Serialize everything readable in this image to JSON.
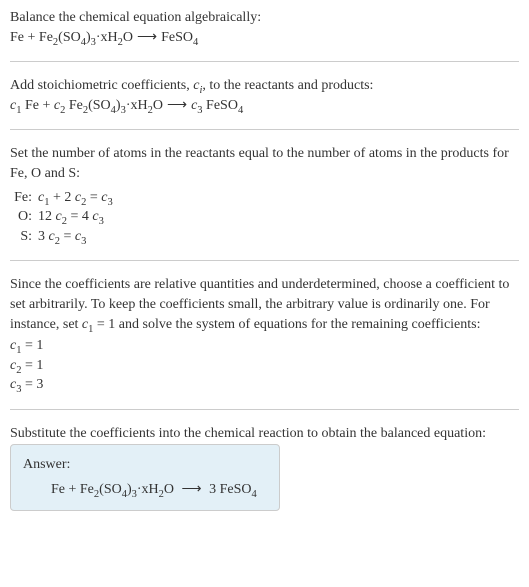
{
  "intro": {
    "line1": "Balance the chemical equation algebraically:",
    "equation_parts": {
      "r1": "Fe",
      "plus": " + ",
      "r2_a": "Fe",
      "r2_b": "(SO",
      "r2_c": ")",
      "r2_d": "·xH",
      "r2_e": "O",
      "arrow": " ⟶ ",
      "p1_a": "FeSO"
    }
  },
  "step1": {
    "text_a": "Add stoichiometric coefficients, ",
    "text_b": ", to the reactants and products:"
  },
  "step2": {
    "text": "Set the number of atoms in the reactants equal to the number of atoms in the products for Fe, O and S:",
    "rows": [
      {
        "label": "Fe:",
        "lhs_a": "c",
        "lhs_b": " + 2 ",
        "lhs_c": "c",
        "eq": " = ",
        "rhs_a": "c"
      },
      {
        "label": "O:",
        "lhs_a": "12 ",
        "lhs_b": "c",
        "eq": " = 4 ",
        "rhs_a": "c"
      },
      {
        "label": "S:",
        "lhs_a": "3 ",
        "lhs_b": "c",
        "eq": " = ",
        "rhs_a": "c"
      }
    ]
  },
  "step3": {
    "text_a": "Since the coefficients are relative quantities and underdetermined, choose a coefficient to set arbitrarily. To keep the coefficients small, the arbitrary value is ordinarily one. For instance, set ",
    "text_b": " = 1 and solve the system of equations for the remaining coefficients:",
    "coeffs": [
      {
        "var": "c",
        "sub": "1",
        "val": " = 1"
      },
      {
        "var": "c",
        "sub": "2",
        "val": " = 1"
      },
      {
        "var": "c",
        "sub": "3",
        "val": " = 3"
      }
    ]
  },
  "step4": {
    "text": "Substitute the coefficients into the chemical reaction to obtain the balanced equation:"
  },
  "answer": {
    "label": "Answer:",
    "eq_parts": {
      "r1": "Fe + Fe",
      "r2": "(SO",
      "r3": ")",
      "r4": "·xH",
      "r5": "O ",
      "arrow": " ⟶ ",
      "p1": " 3 FeSO"
    }
  },
  "subs": {
    "s2": "2",
    "s3": "3",
    "s4": "4",
    "si": "i",
    "s1": "1"
  },
  "chart_data": {
    "type": "table",
    "title": "Atom balance equations",
    "rows": [
      {
        "element": "Fe",
        "equation": "c1 + 2 c2 = c3"
      },
      {
        "element": "O",
        "equation": "12 c2 = 4 c3"
      },
      {
        "element": "S",
        "equation": "3 c2 = c3"
      }
    ],
    "solution": {
      "c1": 1,
      "c2": 1,
      "c3": 3
    },
    "balanced_equation": "Fe + Fe2(SO4)3·xH2O ⟶ 3 FeSO4"
  }
}
